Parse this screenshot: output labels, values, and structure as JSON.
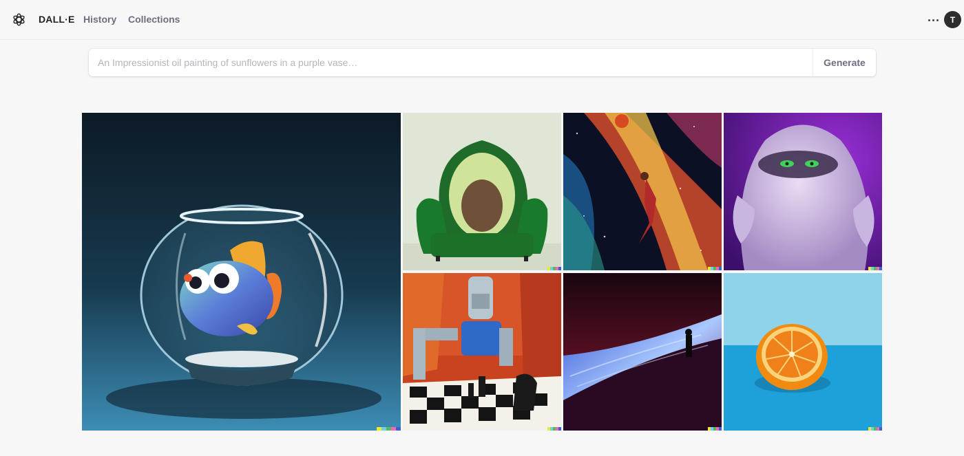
{
  "header": {
    "logo_icon": "openai-logo-icon",
    "brand": "DALL·E",
    "nav": [
      {
        "label": "History"
      },
      {
        "label": "Collections"
      }
    ],
    "more_icon": "more-horizontal-icon",
    "avatar_initial": "T"
  },
  "prompt": {
    "placeholder": "An Impressionist oil painting of sunflowers in a purple vase…",
    "value": "",
    "generate_label": "Generate"
  },
  "gallery": {
    "images": [
      {
        "subject": "fish-in-bowl-image"
      },
      {
        "subject": "avocado-armchair-image"
      },
      {
        "subject": "space-basketball-image"
      },
      {
        "subject": "purple-furry-monster-image"
      },
      {
        "subject": "robot-chess-painting-image"
      },
      {
        "subject": "dune-silhouette-image"
      },
      {
        "subject": "orange-half-image"
      }
    ],
    "signature_colors": [
      "#f5e72a",
      "#6ad4e6",
      "#5ab85a",
      "#f26bb0",
      "#3a5fd6"
    ]
  }
}
